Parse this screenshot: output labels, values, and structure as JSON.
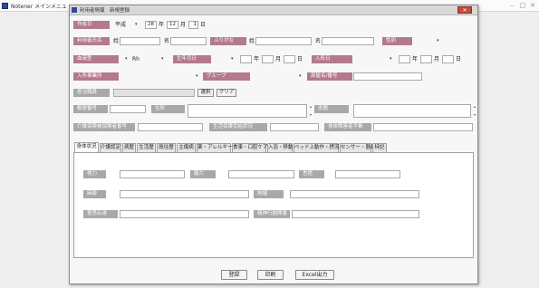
{
  "main_window": {
    "title": "Notener メインメニュ"
  },
  "dialog": {
    "title": "利用者情報　新規登録"
  },
  "form": {
    "creation_date": {
      "label": "作成日",
      "era": "平成",
      "year": "28",
      "year_unit": "年",
      "month": "12",
      "month_unit": "月",
      "day": "1",
      "day_unit": "日"
    },
    "user_name": {
      "label": "利用者氏名",
      "last_prefix": "姓",
      "first_prefix": "名"
    },
    "furigana": {
      "label": "ふりがな",
      "last_prefix": "姓",
      "first_prefix": "名"
    },
    "gender": {
      "label": "性別"
    },
    "blood_type": {
      "label": "血液型",
      "rh": "Rh"
    },
    "birth_date": {
      "label": "生年月日",
      "year_unit": "年",
      "month_unit": "月",
      "day_unit": "日"
    },
    "admission_date": {
      "label": "入所日",
      "year_unit": "年",
      "month_unit": "月",
      "day_unit": "日"
    },
    "entry_office": {
      "label": "入所事業所"
    },
    "group": {
      "label": "グループ"
    },
    "room": {
      "label": "部屋名/番号"
    },
    "staff": {
      "label": "担当職員",
      "select_button": "選択",
      "clear_button": "クリア"
    },
    "postal_code": {
      "label": "郵便番号"
    },
    "address": {
      "label": "住所"
    },
    "domicile": {
      "label": "本籍"
    },
    "care_insurance": {
      "label": "介護保険被保険者番号"
    },
    "welfare": {
      "label": "生活保護受給状況"
    },
    "disability": {
      "label": "身体障害者手帳"
    }
  },
  "tabs": [
    {
      "label": "身体状況",
      "active": true
    },
    {
      "label": "介護認定",
      "active": false
    },
    {
      "label": "病歴",
      "active": false
    },
    {
      "label": "生活歴",
      "active": false
    },
    {
      "label": "既往歴",
      "active": false
    },
    {
      "label": "主傷病",
      "active": false
    },
    {
      "label": "薬・アレルギー",
      "active": false
    },
    {
      "label": "食事・口腔ケア",
      "active": false
    },
    {
      "label": "入浴・移動",
      "active": false
    },
    {
      "label": "ベッド上動作・摂流",
      "active": false
    },
    {
      "label": "センサー・器具",
      "active": false
    },
    {
      "label": "特記",
      "active": false
    }
  ],
  "body_status": {
    "vision": "視力",
    "hearing": "聴力",
    "speech": "言語",
    "paralysis": "麻痺",
    "contracture": "拘縮",
    "communication": "意思伝達",
    "mental_disorder": "精神行動障害"
  },
  "buttons": {
    "register": "登録",
    "print": "印刷",
    "excel": "Excel出力"
  },
  "icons": {
    "dropdown": "▾",
    "spin_up": "▴",
    "spin_down": "▾",
    "close": "✕",
    "minimize": "–",
    "maximize": "□"
  },
  "colors": {
    "label_bg": "#b47a8c",
    "label_grey": "#a8a8a8",
    "close_button": "#c64b3b"
  }
}
